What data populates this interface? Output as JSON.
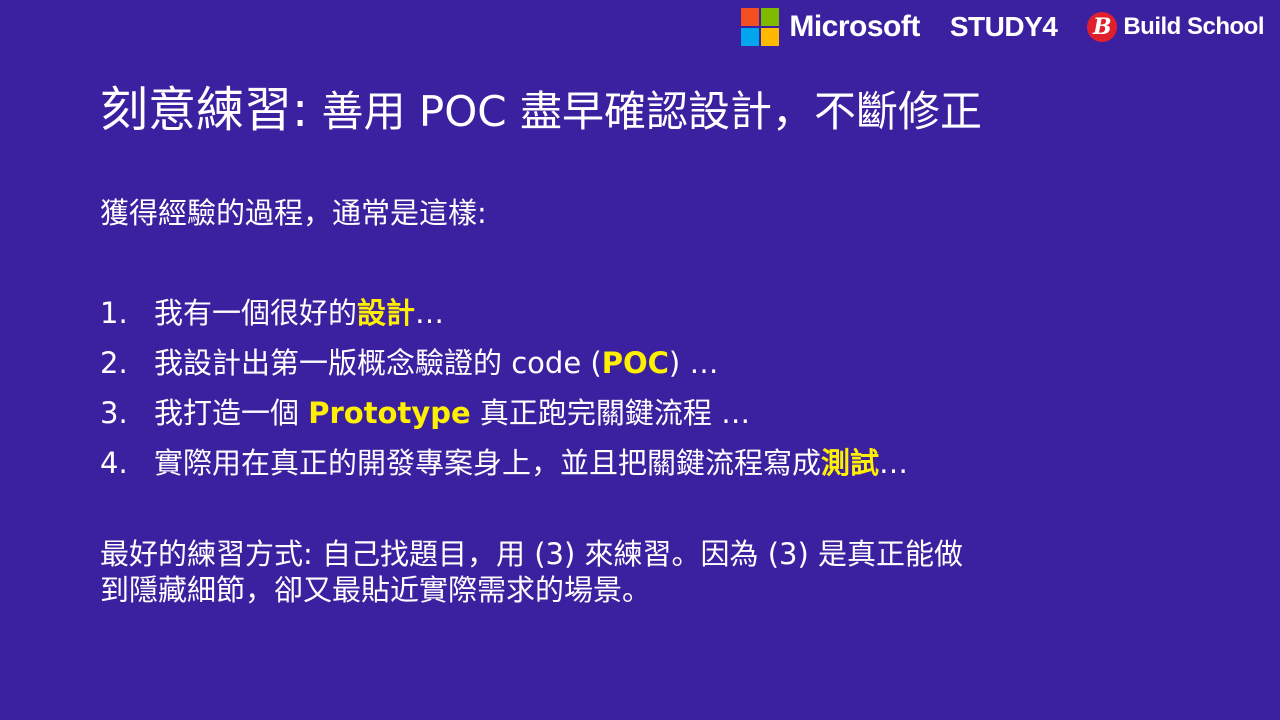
{
  "logos": {
    "microsoft": "Microsoft",
    "study4": "STUDY4",
    "buildschool_mark": "B",
    "buildschool": "Build School",
    "ms_colors": [
      "#f25022",
      "#7fba00",
      "#00a4ef",
      "#ffb900"
    ]
  },
  "title": {
    "main": "刻意練習:",
    "sub": " 善用 POC 盡早確認設計，不斷修正"
  },
  "intro": "獲得經驗的過程，通常是這樣:",
  "steps": [
    {
      "num": "1.",
      "pre": "我有一個很好的",
      "hl": "設計",
      "post": "…"
    },
    {
      "num": "2.",
      "pre": "我設計出第一版概念驗證的 code (",
      "hl": "POC",
      "post": ") …"
    },
    {
      "num": "3.",
      "pre": "我打造一個 ",
      "hl": "Prototype",
      "post": " 真正跑完關鍵流程 …"
    },
    {
      "num": "4.",
      "pre": "實際用在真正的開發專案身上，並且把關鍵流程寫成",
      "hl": "測試",
      "post": "…"
    }
  ],
  "closing": {
    "line1": "最好的練習方式: 自己找題目，用 (3) 來練習。因為 (3) 是真正能做",
    "line2": "到隱藏細節，卻又最貼近實際需求的場景。"
  },
  "colors": {
    "background": "#3b21a0",
    "highlight": "#ffef00"
  }
}
